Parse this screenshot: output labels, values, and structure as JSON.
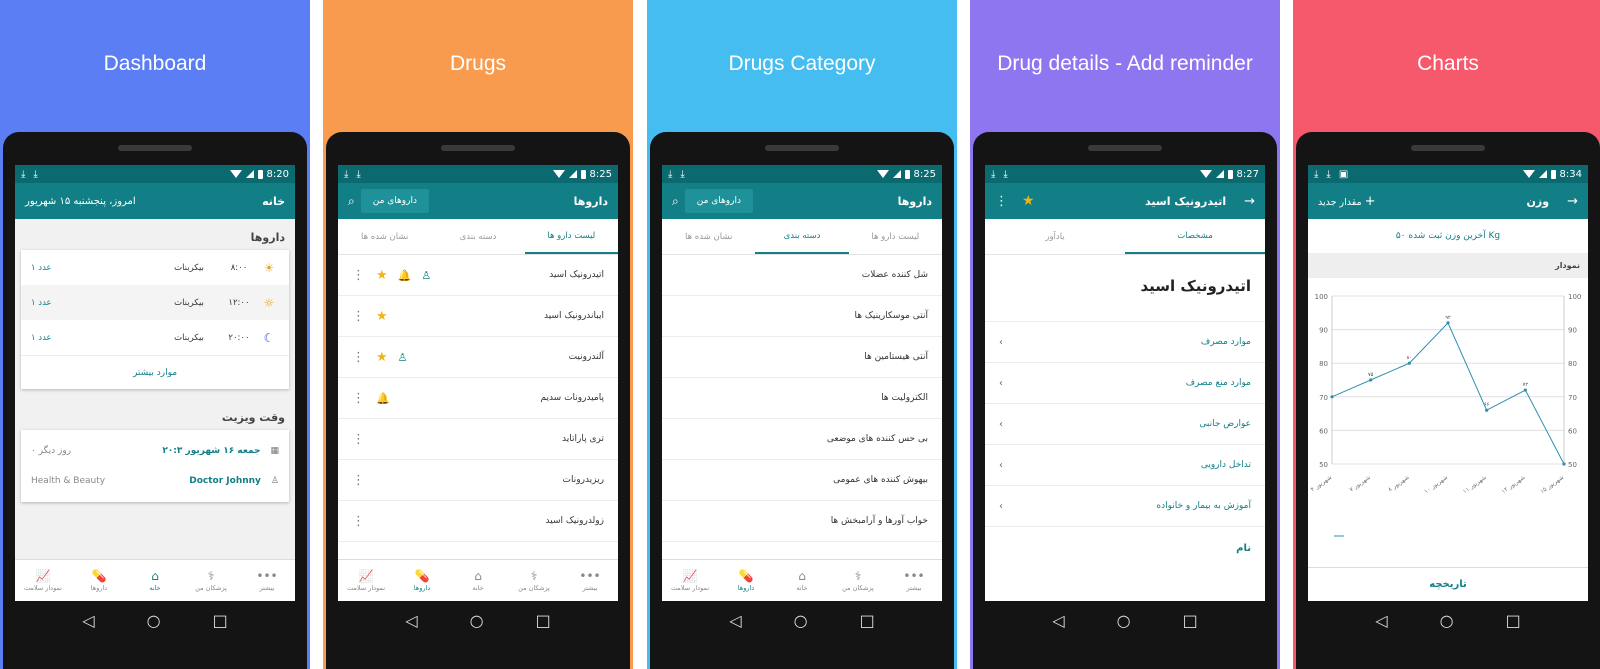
{
  "panels": [
    {
      "title": "Dashboard",
      "time": "8:20"
    },
    {
      "title": "Drugs",
      "time": "8:25"
    },
    {
      "title": "Drugs Category",
      "time": "8:25"
    },
    {
      "title": "Drug details - Add reminder",
      "time": "8:27"
    },
    {
      "title": "Charts",
      "time": "8:34"
    }
  ],
  "colors": {
    "primary": "#127f87",
    "status": "#0b6a70",
    "star": "#f2b415",
    "p1": "#5b7ef5",
    "p2": "#f99b4e",
    "p3": "#45bdf0",
    "p4": "#8e76f0",
    "p5": "#f6596b"
  },
  "nav": {
    "health": "نمودار سلامت",
    "drugs": "داروها",
    "home": "خانه",
    "doctors": "پزشکان من",
    "more": "بیشتر"
  },
  "dashboard": {
    "title": "خانه",
    "today": "امروز، پنجشنبه ۱۵ شهریور",
    "drugs_title": "داروها",
    "doses": [
      {
        "time": "۸:۰۰",
        "name": "بیکربنات",
        "count": "۱ عدد",
        "icon": "sunrise-icon"
      },
      {
        "time": "۱۲:۰۰",
        "name": "بیکربنات",
        "count": "۱ عدد",
        "icon": "sun-icon"
      },
      {
        "time": "۲۰:۰۰",
        "name": "بیکربنات",
        "count": "۱ عدد",
        "icon": "moon-icon"
      }
    ],
    "more": "موارد بیشتر",
    "visit_title": "وقت ویزیت",
    "visit_date": "جمعه ۱۶ شهریور ۲۰:۳",
    "visit_days": "۰ روز دیگر",
    "doctor": "Doctor Johnny",
    "specialty": "Health & Beauty"
  },
  "drugs": {
    "title": "داروها",
    "mydrugs": "داروهای من",
    "tabs": [
      "لیست دارو ها",
      "دسته بندی",
      "نشان شده ها"
    ],
    "items": [
      {
        "name": "اتیدرونیک اسید",
        "star": true,
        "bell": true,
        "person": true
      },
      {
        "name": "ایباندرونیک اسید",
        "star": true,
        "bell": false,
        "person": false
      },
      {
        "name": "آلندرونیت",
        "star": true,
        "bell": false,
        "person": true
      },
      {
        "name": "پامیدرونات سدیم",
        "star": false,
        "bell": true,
        "person": false
      },
      {
        "name": "تری پاراتاید",
        "star": false,
        "bell": false,
        "person": false
      },
      {
        "name": "ریزیدرونات",
        "star": false,
        "bell": false,
        "person": false
      },
      {
        "name": "زولدرونیک اسید",
        "star": false,
        "bell": false,
        "person": false
      }
    ]
  },
  "category": {
    "items": [
      "شل کننده عضلات",
      "آنتی موسکارینیک ها",
      "آنتی هیستامین ها",
      "الکترولیت ها",
      "بی حس کننده های موضعی",
      "بیهوش کننده های عمومی",
      "خواب آورها و آرامبخش ها"
    ]
  },
  "details": {
    "title": "اتیدرونیک اسید",
    "tabs": [
      "مشخصات",
      "یادآور"
    ],
    "big_title": "اتیدرونیک اسید",
    "rows": [
      "موارد مصرف",
      "موارد منع مصرف",
      "عوارض جانبی",
      "تداخل دارویی",
      "آموزش به بیمار و خانواده"
    ],
    "name_label": "نام"
  },
  "charts": {
    "title": "وزن",
    "add": "مقدار جدید",
    "last": "آخرین وزن ثبت شده  ۵۰ Kg",
    "chart_label": "نمودار",
    "history": "تاریخچه"
  },
  "chart_data": {
    "type": "line",
    "x": [
      "۴ شهریور",
      "۷ شهریور",
      "۸ شهریور",
      "۱۰ شهریور",
      "۱۱ شهریور",
      "۱۲ شهریور",
      "۱۵ شهریور"
    ],
    "values": [
      70,
      75,
      80,
      92,
      66,
      72,
      50
    ],
    "point_labels": [
      "",
      "۷۵",
      "۸۰",
      "۹۲",
      "۶۶",
      "۷۲",
      ""
    ],
    "yticks": [
      100,
      90,
      80,
      70,
      60,
      50
    ],
    "ylim": [
      50,
      100
    ],
    "grid": true
  }
}
